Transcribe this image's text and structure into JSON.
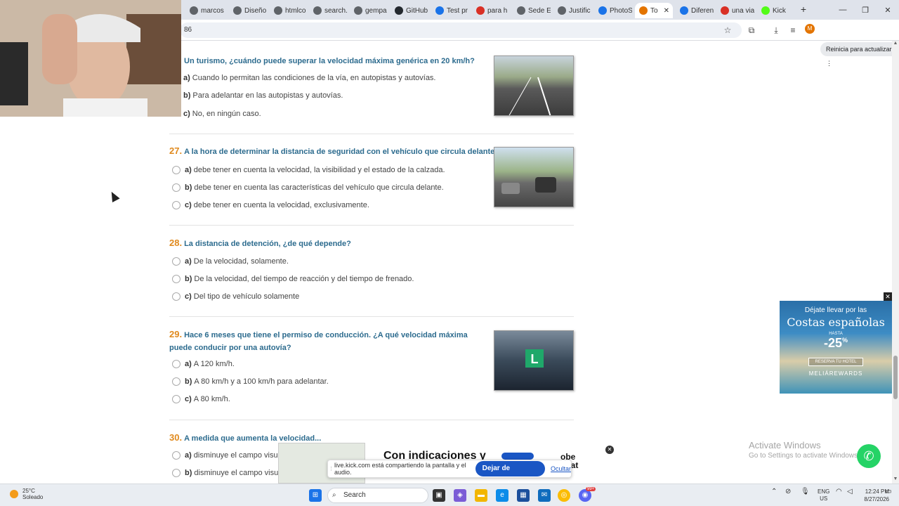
{
  "browser": {
    "tabs": [
      {
        "label": "marcos",
        "color": "#5f6368"
      },
      {
        "label": "Diseño",
        "color": "#5f6368"
      },
      {
        "label": "htmlcol",
        "color": "#5f6368"
      },
      {
        "label": "search.",
        "color": "#5f6368"
      },
      {
        "label": "gempa",
        "color": "#5f6368"
      },
      {
        "label": "GitHub",
        "color": "#24292f"
      },
      {
        "label": "Test pr",
        "color": "#1a73e8"
      },
      {
        "label": "para h",
        "color": "#d93025"
      },
      {
        "label": "Sede El",
        "color": "#5f6368"
      },
      {
        "label": "Justific",
        "color": "#5f6368"
      },
      {
        "label": "PhotoS",
        "color": "#1a73e8"
      },
      {
        "label": "To",
        "color": "#e37400"
      },
      {
        "label": "Diferen",
        "color": "#1a73e8"
      },
      {
        "label": "una via",
        "color": "#d93025"
      },
      {
        "label": "Kick",
        "color": "#53fc18"
      }
    ],
    "url": "86",
    "update_label": "Reinicia para actualizar",
    "profile_initial": "M"
  },
  "quiz": {
    "q26": {
      "title": "Un turismo, ¿cuándo puede superar la velocidad máxima genérica en 20 km/h?",
      "options": [
        {
          "letter": "a)",
          "text": "Cuando lo permitan las condiciones de la vía, en autopistas y autovías."
        },
        {
          "letter": "b)",
          "text": "Para adelantar en las autopistas y autovías."
        },
        {
          "letter": "c)",
          "text": "No, en ningún caso."
        }
      ]
    },
    "q27": {
      "number": "27.",
      "title": "A la hora de determinar la distancia de seguridad con el vehículo que circula delante...",
      "options": [
        {
          "letter": "a)",
          "text": "debe tener en cuenta la velocidad, la visibilidad y el estado de la calzada."
        },
        {
          "letter": "b)",
          "text": "debe tener en cuenta las características del vehículo que circula delante."
        },
        {
          "letter": "c)",
          "text": "debe tener en cuenta la velocidad, exclusivamente."
        }
      ]
    },
    "q28": {
      "number": "28.",
      "title": "La distancia de detención, ¿de qué depende?",
      "options": [
        {
          "letter": "a)",
          "text": "De la velocidad, solamente."
        },
        {
          "letter": "b)",
          "text": "De la velocidad, del tiempo de reacción y del tiempo de frenado."
        },
        {
          "letter": "c)",
          "text": "Del tipo de vehículo solamente"
        }
      ]
    },
    "q29": {
      "number": "29.",
      "title": "Hace 6 meses que tiene el permiso de conducción. ¿A qué velocidad máxima puede conducir por una autovía?",
      "options": [
        {
          "letter": "a)",
          "text": "A 120 km/h."
        },
        {
          "letter": "b)",
          "text": "A 80 km/h y a 100 km/h para adelantar."
        },
        {
          "letter": "c)",
          "text": "A 80 km/h."
        }
      ]
    },
    "q30": {
      "number": "30.",
      "title": "A medida que aumenta la velocidad...",
      "options": [
        {
          "letter": "a)",
          "text": "disminuye el campo visu"
        },
        {
          "letter": "b)",
          "text": "disminuye el campo visu"
        }
      ]
    }
  },
  "ad": {
    "line1": "Déjate llevar por las",
    "line2": "Costas españolas",
    "hasta": "HASTA",
    "discount": "-25",
    "percent": "%",
    "cta": "RESERVA TU HOTEL",
    "brand": "MELIÁREWARDS"
  },
  "banner_ad": {
    "headline": "Con indicaciones y",
    "brand": "obe obat"
  },
  "share": {
    "message": "live.kick.com está compartiendo la pantalla y el audio.",
    "stop_label": "Dejar de compartir",
    "hide_label": "Ocultar"
  },
  "watermark": {
    "title": "Activate Windows",
    "subtitle": "Go to Settings to activate Windows."
  },
  "taskbar": {
    "temperature": "25°C",
    "weather": "Soleado",
    "search_label": "Search",
    "lang1": "ENG",
    "lang2": "US",
    "time": "12:24 PM",
    "date": "8/27/2026",
    "badge": "99+"
  }
}
